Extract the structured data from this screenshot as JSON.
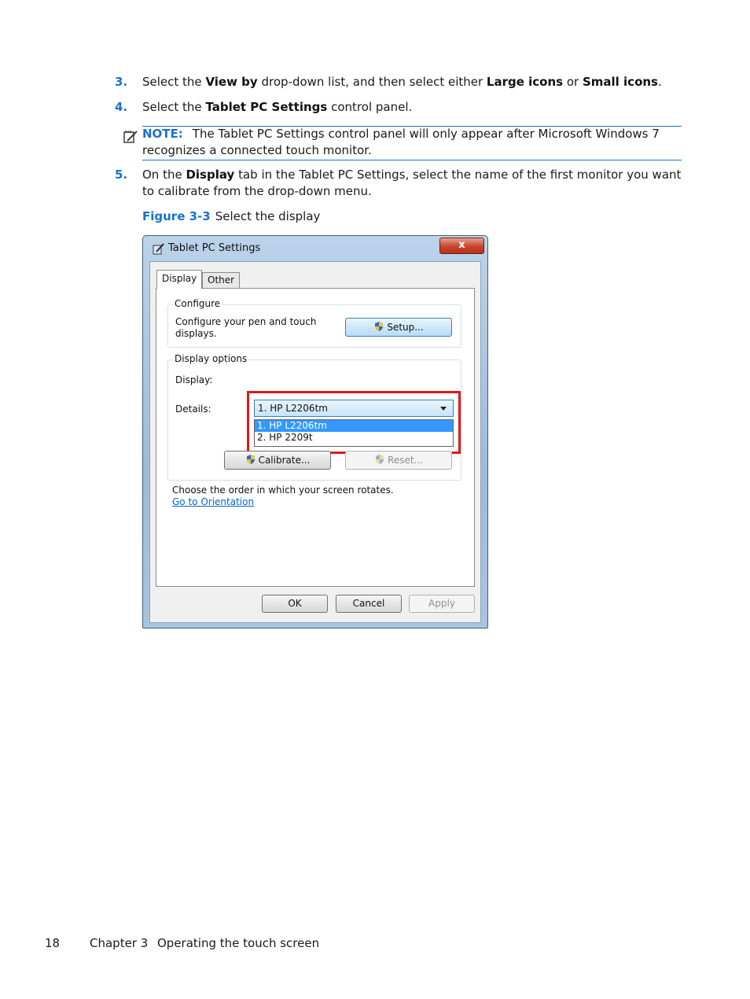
{
  "steps": [
    {
      "number": "3.",
      "parts": [
        "Select the ",
        "View by",
        " drop-down list, and then select either ",
        "Large icons",
        " or ",
        "Small icons",
        "."
      ]
    },
    {
      "number": "4.",
      "parts": [
        "Select the ",
        "Tablet PC Settings",
        " control panel."
      ]
    },
    {
      "number": "5.",
      "parts": [
        "On the ",
        "Display",
        " tab in the Tablet PC Settings, select the name of the first monitor you want to calibrate from the drop-down menu."
      ]
    }
  ],
  "note": {
    "label": "NOTE:",
    "text": "The Tablet PC Settings control panel will only appear after Microsoft Windows 7 recognizes a connected touch monitor."
  },
  "figure": {
    "label": "Figure 3-3",
    "caption": "Select the display"
  },
  "dialog": {
    "title": "Tablet PC Settings",
    "close_label": "x",
    "tabs": [
      {
        "label": "Display",
        "active": true
      },
      {
        "label": "Other",
        "active": false
      }
    ],
    "configure": {
      "title": "Configure",
      "description_line1": "Configure your pen and touch",
      "description_line2": "displays.",
      "setup_label": "Setup..."
    },
    "display_options": {
      "title": "Display options",
      "display_label": "Display:",
      "details_label": "Details:",
      "selected": "1. HP L2206tm",
      "options": [
        "1. HP L2206tm",
        "2. HP 2209t"
      ],
      "calibrate_label": "Calibrate...",
      "reset_label": "Reset..."
    },
    "orientation_text": "Choose the order in which your screen rotates.",
    "orientation_link": "Go to Orientation",
    "ok_label": "OK",
    "cancel_label": "Cancel",
    "apply_label": "Apply"
  },
  "footer": {
    "page_number": "18",
    "chapter": "Chapter 3",
    "chapter_title": "Operating the touch screen"
  },
  "colors": {
    "accent_blue": "#1a73c8",
    "highlight_red": "#e01818",
    "selection_blue": "#3399ff"
  }
}
